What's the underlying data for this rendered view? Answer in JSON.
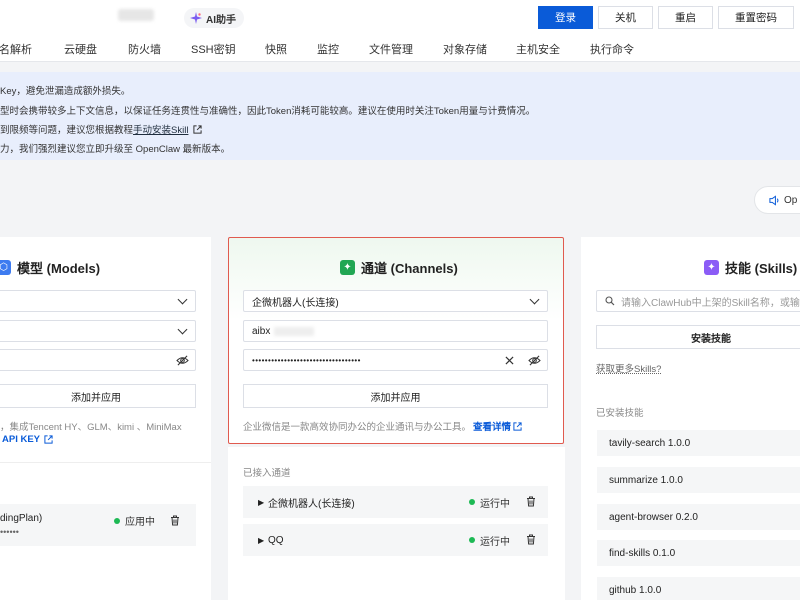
{
  "header": {
    "ai_label": "AI助手",
    "buttons": {
      "login": "登录",
      "shutdown": "关机",
      "restart": "重启",
      "reset_password": "重置密码"
    }
  },
  "tabs": [
    "域名解析",
    "云硬盘",
    "防火墙",
    "SSH密钥",
    "快照",
    "监控",
    "文件管理",
    "对象存储",
    "主机安全",
    "执行命令"
  ],
  "notice": {
    "line1": "Key，避免泄漏造成额外损失。",
    "line2": "型时会携带较多上下文信息，以保证任务连贯性与准确性，因此Token消耗可能较高。建议在使用时关注Token用量与计费情况。",
    "line3_prefix": "到限频等问题，建议您根据教程",
    "line3_link": "手动安装Skill",
    "line4": "力，我们强烈建议您立即升级至 OpenClaw 最新版本。"
  },
  "op_pill": "Op",
  "models": {
    "title": "模型 (Models)",
    "apply_button": "添加并应用",
    "desc": "，集成Tencent HY、GLM、kimi 、MiniMax",
    "api_key_link": "API KEY",
    "item_name": "dingPlan)",
    "item_status": "应用中",
    "item_masked": "••••••"
  },
  "channels": {
    "title": "通道 (Channels)",
    "type_value": "企微机器人(长连接)",
    "bot_id": "aibx",
    "secret_masked": "••••••••••••••••••••••••••••••••••",
    "apply_button": "添加并应用",
    "desc": "企业微信是一款高效协同办公的企业通讯与办公工具。",
    "detail_link": "查看详情",
    "connected_label": "已接入通道",
    "connected": [
      {
        "name": "企微机器人(长连接)",
        "status": "运行中"
      },
      {
        "name": "QQ",
        "status": "运行中"
      }
    ]
  },
  "skills": {
    "title": "技能 (Skills)",
    "search_placeholder": "请输入ClawHub中上架的Skill名称，或输入",
    "install_button": "安装技能",
    "more_link": "获取更多Skills?",
    "installed_label": "已安装技能",
    "installed": [
      "tavily-search 1.0.0",
      "summarize 1.0.0",
      "agent-browser 0.2.0",
      "find-skills 0.1.0",
      "github 1.0.0"
    ]
  },
  "colors": {
    "primary": "#0a5bd8",
    "success": "#1db954",
    "highlight_border": "#e05a4f",
    "notice_bg": "#e8eefc"
  }
}
